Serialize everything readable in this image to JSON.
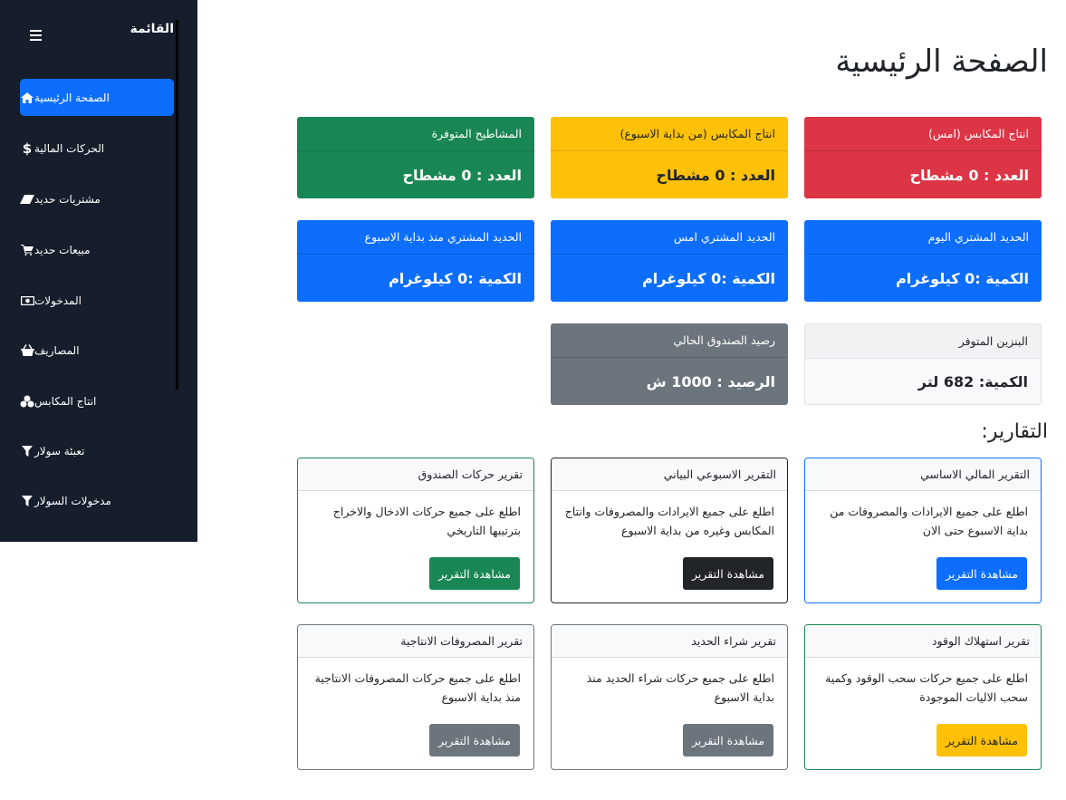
{
  "sidebar": {
    "title": "القائمة",
    "items": [
      {
        "label": "الصفحة الرئيسية",
        "icon": "home-icon"
      },
      {
        "label": "الحركات المالية",
        "icon": "dollar-icon"
      },
      {
        "label": "مشتريات حديد",
        "icon": "eraser-icon"
      },
      {
        "label": "مبيعات حديد",
        "icon": "cart-icon"
      },
      {
        "label": "المدخولات",
        "icon": "money-bill-icon"
      },
      {
        "label": "المصاريف",
        "icon": "basket-icon"
      },
      {
        "label": "انتاج المكابس",
        "icon": "cubes-icon"
      },
      {
        "label": "تعبئة سولار",
        "icon": "filter-icon"
      },
      {
        "label": "مدخولات السولار",
        "icon": "filter-icon"
      }
    ]
  },
  "main": {
    "title": "الصفحة الرئيسية",
    "reports_title": "التقارير:",
    "stats": [
      {
        "header": "انتاج المكابس (امس)",
        "value": "العدد : 0 مشطاح"
      },
      {
        "header": "انتاج المكابس (من بداية الاسبوع)",
        "value": "العدد : 0 مشطاح"
      },
      {
        "header": "المشاطيح المتوفرة",
        "value": "العدد : 0 مشطاح"
      },
      {
        "header": "الحديد المشتري اليوم",
        "value": "الكمية :0 كيلوغرام"
      },
      {
        "header": "الحديد المشتري امس",
        "value": "الكمية :0 كيلوغرام"
      },
      {
        "header": "الحديد المشتري منذ بداية الاسبوع",
        "value": "الكمية :0 كيلوغرام"
      },
      {
        "header": "البنزين المتوفر",
        "value": "الكمية: 682 لتر"
      },
      {
        "header": "رصيد الصندوق الحالي",
        "value": "الرصيد : 1000 ش"
      }
    ],
    "reports": [
      {
        "header": "التقرير المالي الاساسي",
        "text": "اطلع على جميع الايرادات والمصروفات من بداية الاسبوع حتى الان",
        "button": "مشاهدة التقرير"
      },
      {
        "header": "التقرير الاسبوعي البياني",
        "text": "اطلع على جميع الايرادات والمصروفات وانتاج المكابس وغيره من بداية الاسبوع",
        "button": "مشاهدة التقرير"
      },
      {
        "header": "تقرير حركات الصندوق",
        "text": "اطلع على جميع حركات الادخال والاخراج بترتيبها التاريخي",
        "button": "مشاهدة التقرير"
      },
      {
        "header": "تقرير استهلاك الوقود",
        "text": "اطلع على جميع حركات سحب الوقود وكمية سحب الاليات الموجودة",
        "button": "مشاهدة التقرير"
      },
      {
        "header": "تقرير شراء الحديد",
        "text": "اطلع على جميع حركات شراء الحديد منذ بداية الاسبوع",
        "button": "مشاهدة التقرير"
      },
      {
        "header": "تقرير المصروفات الانتاجية",
        "text": "اطلع على جميع حركات المصروفات الانتاجية منذ بداية الاسبوع",
        "button": "مشاهدة التقرير"
      }
    ]
  },
  "colors": {
    "sidebar_bg": "#161d2b",
    "primary": "#0d6efd",
    "danger": "#dc3545",
    "warning": "#ffc107",
    "success": "#198754",
    "secondary": "#6c757d",
    "dark": "#212529"
  }
}
